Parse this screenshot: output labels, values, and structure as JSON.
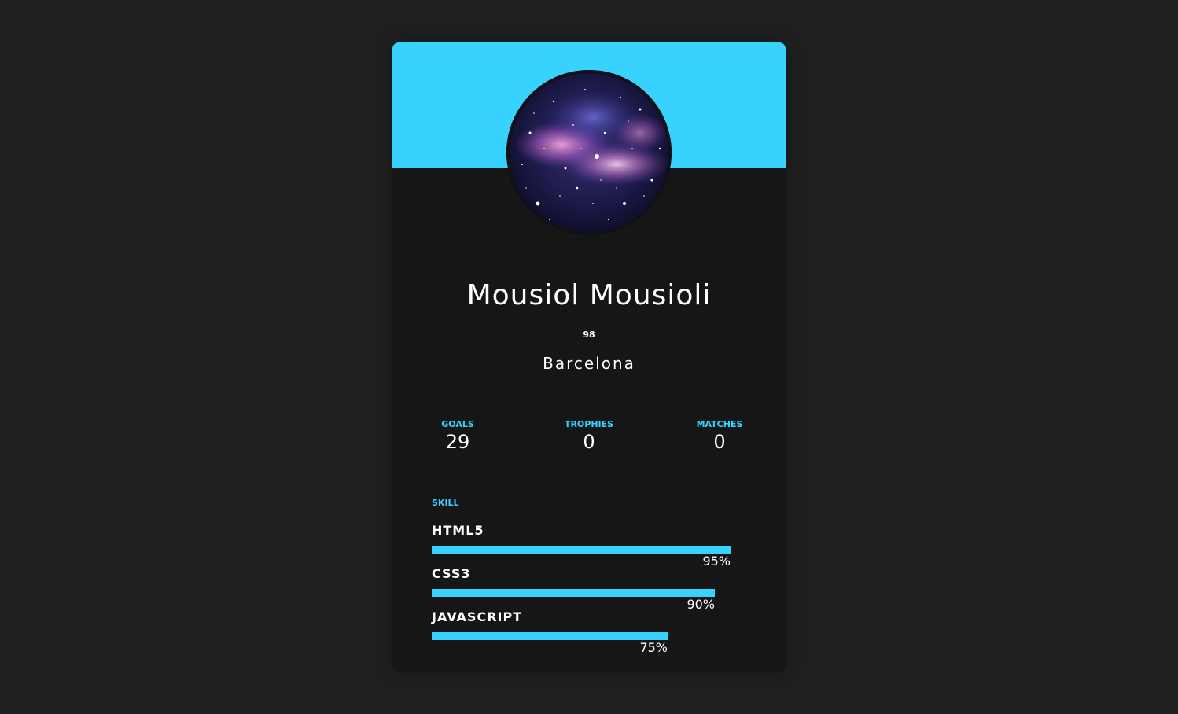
{
  "colors": {
    "page_background": "#202020",
    "card_background": "#161616",
    "accent": "#38d2ff",
    "text": "#ffffff"
  },
  "profile": {
    "avatar_icon": "galaxy-avatar",
    "name": "Mousiol Mousioli",
    "rating": "98",
    "team": "Barcelona"
  },
  "stats": [
    {
      "label": "GOALS",
      "value": "29"
    },
    {
      "label": "TROPHIES",
      "value": "0"
    },
    {
      "label": "MATCHES",
      "value": "0"
    }
  ],
  "skills": {
    "title": "SKILL",
    "items": [
      {
        "name": "HTML5",
        "percent_label": "95%",
        "level": 0.95
      },
      {
        "name": "CSS3",
        "percent_label": "90%",
        "level": 0.9
      },
      {
        "name": "JAVASCRIPT",
        "percent_label": "75%",
        "level": 0.75
      }
    ]
  }
}
